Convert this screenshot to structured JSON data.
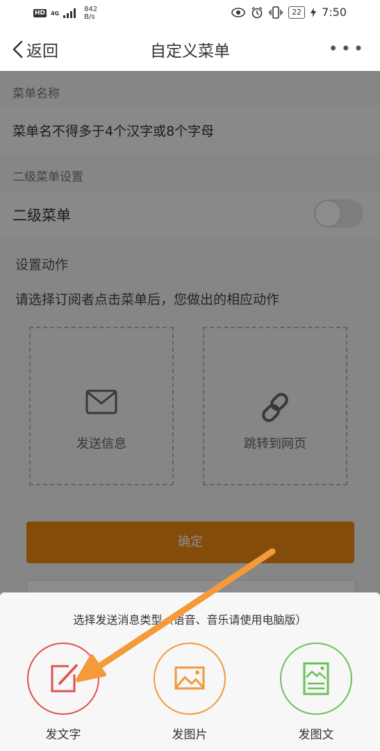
{
  "status_bar": {
    "hd": "HD",
    "network": "4G",
    "speed_value": "842",
    "speed_unit": "B/s",
    "battery": "22",
    "time": "7:50"
  },
  "header": {
    "back_label": "返回",
    "title": "自定义菜单",
    "more_label": "•••"
  },
  "form": {
    "menu_name_label": "菜单名称",
    "menu_name_placeholder": "菜单名不得多于4个汉字或8个字母",
    "submenu_section_label": "二级菜单设置",
    "submenu_toggle_label": "二级菜单",
    "submenu_toggle_on": false,
    "action_section_label": "设置动作",
    "action_hint": "请选择订阅者点击菜单后，您做出的相应动作",
    "actions": [
      {
        "label": "发送信息",
        "icon": "envelope-icon"
      },
      {
        "label": "跳转到网页",
        "icon": "link-icon"
      }
    ],
    "confirm_label": "确定"
  },
  "sheet": {
    "title": "选择发送消息类型（语音、音乐请使用电脑版）",
    "options": [
      {
        "label": "发文字",
        "icon": "edit-text-icon",
        "color": "#e0504c"
      },
      {
        "label": "发图片",
        "icon": "image-icon",
        "color": "#f09a3c"
      },
      {
        "label": "发图文",
        "icon": "image-text-icon",
        "color": "#6cc05a"
      }
    ]
  },
  "colors": {
    "accent_orange": "#f08a14",
    "arrow": "#f49a3a"
  }
}
